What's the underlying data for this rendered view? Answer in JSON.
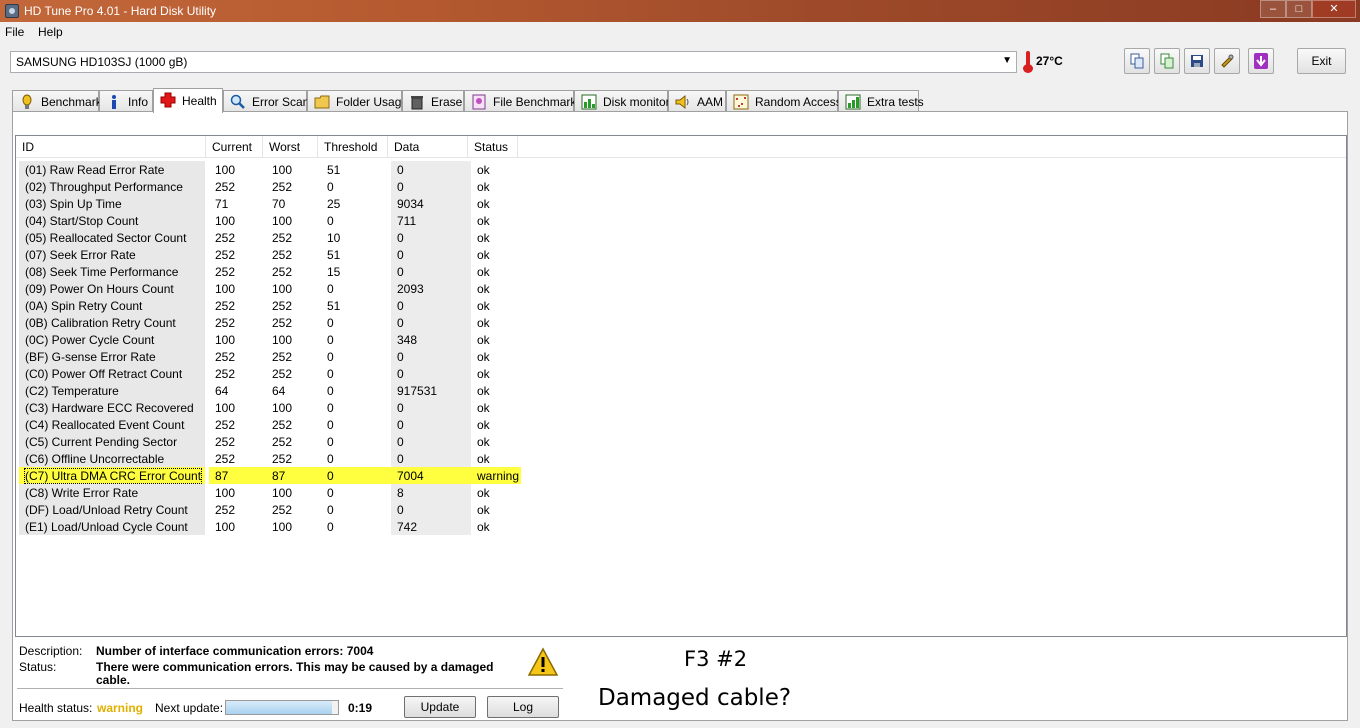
{
  "window": {
    "title": "HD Tune Pro 4.01 - Hard Disk Utility",
    "controls": [
      "–",
      "□",
      "✕"
    ]
  },
  "menu": [
    "File",
    "Help"
  ],
  "toolbar": {
    "drive": "SAMSUNG HD103SJ (1000 gB)",
    "temperature": "27°C",
    "icons": [
      "copy-text-icon",
      "copy-screenshot-icon",
      "save-icon",
      "options-icon",
      "download-icon"
    ],
    "exit_label": "Exit"
  },
  "tabs": [
    {
      "label": "Benchmark",
      "icon": "benchmark-icon"
    },
    {
      "label": "Info",
      "icon": "info-icon"
    },
    {
      "label": "Health",
      "icon": "health-cross-icon",
      "active": true
    },
    {
      "label": "Error Scan",
      "icon": "error-scan-icon"
    },
    {
      "label": "Folder Usage",
      "icon": "folder-icon"
    },
    {
      "label": "Erase",
      "icon": "erase-icon"
    },
    {
      "label": "File Benchmark",
      "icon": "file-benchmark-icon"
    },
    {
      "label": "Disk monitor",
      "icon": "disk-monitor-icon"
    },
    {
      "label": "AAM",
      "icon": "speaker-icon"
    },
    {
      "label": "Random Access",
      "icon": "random-access-icon"
    },
    {
      "label": "Extra tests",
      "icon": "extra-tests-icon"
    }
  ],
  "smart_table": {
    "columns": [
      "ID",
      "Current",
      "Worst",
      "Threshold",
      "Data",
      "Status"
    ],
    "rows": [
      [
        "(01) Raw Read Error Rate",
        "100",
        "100",
        "51",
        "0",
        "ok"
      ],
      [
        "(02) Throughput Performance",
        "252",
        "252",
        "0",
        "0",
        "ok"
      ],
      [
        "(03) Spin Up Time",
        "71",
        "70",
        "25",
        "9034",
        "ok"
      ],
      [
        "(04) Start/Stop Count",
        "100",
        "100",
        "0",
        "711",
        "ok"
      ],
      [
        "(05) Reallocated Sector Count",
        "252",
        "252",
        "10",
        "0",
        "ok"
      ],
      [
        "(07) Seek Error Rate",
        "252",
        "252",
        "51",
        "0",
        "ok"
      ],
      [
        "(08) Seek Time Performance",
        "252",
        "252",
        "15",
        "0",
        "ok"
      ],
      [
        "(09) Power On Hours Count",
        "100",
        "100",
        "0",
        "2093",
        "ok"
      ],
      [
        "(0A) Spin Retry Count",
        "252",
        "252",
        "51",
        "0",
        "ok"
      ],
      [
        "(0B) Calibration Retry Count",
        "252",
        "252",
        "0",
        "0",
        "ok"
      ],
      [
        "(0C) Power Cycle Count",
        "100",
        "100",
        "0",
        "348",
        "ok"
      ],
      [
        "(BF) G-sense Error Rate",
        "252",
        "252",
        "0",
        "0",
        "ok"
      ],
      [
        "(C0) Power Off Retract Count",
        "252",
        "252",
        "0",
        "0",
        "ok"
      ],
      [
        "(C2) Temperature",
        "64",
        "64",
        "0",
        "917531",
        "ok"
      ],
      [
        "(C3) Hardware ECC Recovered",
        "100",
        "100",
        "0",
        "0",
        "ok"
      ],
      [
        "(C4) Reallocated Event Count",
        "252",
        "252",
        "0",
        "0",
        "ok"
      ],
      [
        "(C5) Current Pending Sector",
        "252",
        "252",
        "0",
        "0",
        "ok"
      ],
      [
        "(C6) Offline Uncorrectable",
        "252",
        "252",
        "0",
        "0",
        "ok"
      ],
      [
        "(C7) Ultra DMA CRC Error Count",
        "87",
        "87",
        "0",
        "7004",
        "warning"
      ],
      [
        "(C8) Write Error Rate",
        "100",
        "100",
        "0",
        "8",
        "ok"
      ],
      [
        "(DF) Load/Unload Retry Count",
        "252",
        "252",
        "0",
        "0",
        "ok"
      ],
      [
        "(E1) Load/Unload Cycle Count",
        "100",
        "100",
        "0",
        "742",
        "ok"
      ]
    ],
    "warning_color": "#ffff40"
  },
  "details": {
    "description_label": "Description:",
    "description": "Number of interface communication errors: 7004",
    "status_label": "Status:",
    "status_line1": "There were communication errors. This may be caused by a damaged",
    "status_line2": "cable."
  },
  "footer": {
    "health_label": "Health status:",
    "health_value": "warning",
    "next_update_label": "Next update:",
    "progress": 0.95,
    "timer": "0:19",
    "update_label": "Update",
    "log_label": "Log"
  },
  "annotations": {
    "line1": "F3 #2",
    "line2": "Damaged cable?"
  }
}
